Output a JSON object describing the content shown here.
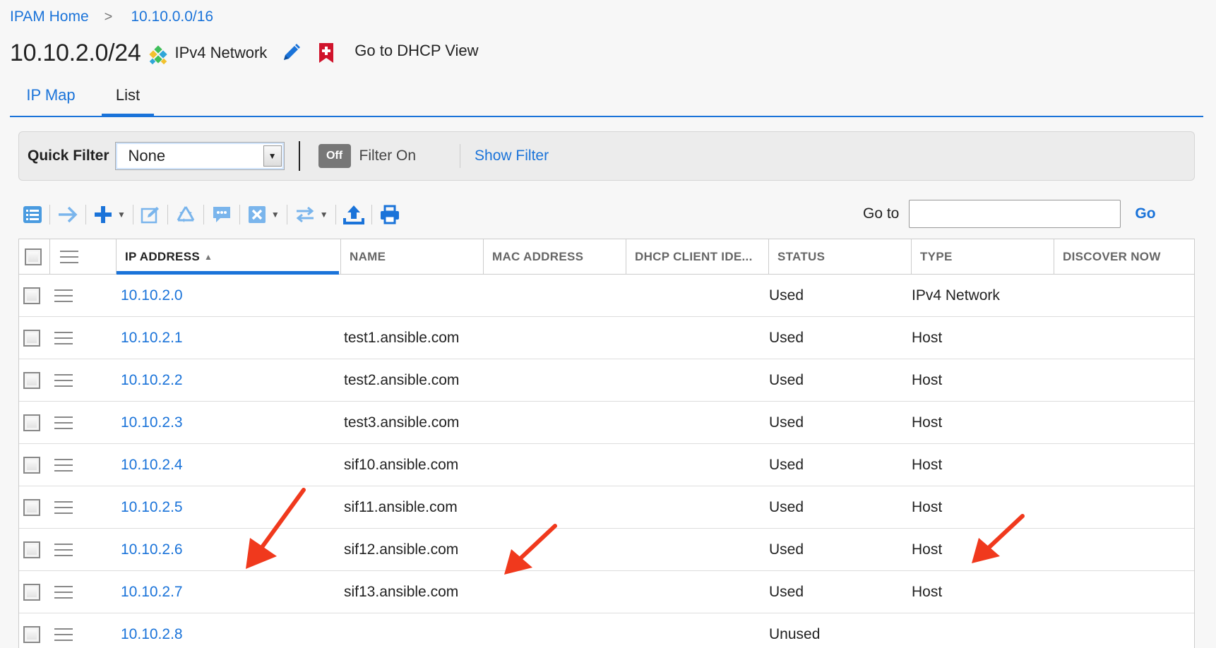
{
  "breadcrumb": {
    "home": "IPAM Home",
    "separator": ">",
    "parent": "10.10.0.0/16"
  },
  "header": {
    "network": "10.10.2.0/24",
    "network_type": "IPv4 Network",
    "dhcp_link": "Go to DHCP View"
  },
  "tabs": [
    {
      "label": "IP Map"
    },
    {
      "label": "List"
    }
  ],
  "filter": {
    "label": "Quick Filter",
    "selected": "None",
    "toggle": "Off",
    "toggle_text": "Filter On",
    "show_filter": "Show Filter"
  },
  "toolbar": {
    "icons": [
      "list-view-icon",
      "next-arrow-icon",
      "add-icon",
      "edit-icon",
      "recycle-icon",
      "comment-icon",
      "delete-icon",
      "swap-icon",
      "upload-icon",
      "print-icon"
    ],
    "goto_label": "Go to",
    "goto_value": "",
    "go_label": "Go"
  },
  "table": {
    "columns": [
      "IP ADDRESS",
      "NAME",
      "MAC ADDRESS",
      "DHCP CLIENT IDE...",
      "STATUS",
      "TYPE",
      "DISCOVER NOW"
    ],
    "rows": [
      {
        "ip": "10.10.2.0",
        "name": "",
        "mac": "",
        "dhcp": "",
        "status": "Used",
        "type": "IPv4 Network",
        "discover": ""
      },
      {
        "ip": "10.10.2.1",
        "name": "test1.ansible.com",
        "mac": "",
        "dhcp": "",
        "status": "Used",
        "type": "Host",
        "discover": ""
      },
      {
        "ip": "10.10.2.2",
        "name": "test2.ansible.com",
        "mac": "",
        "dhcp": "",
        "status": "Used",
        "type": "Host",
        "discover": ""
      },
      {
        "ip": "10.10.2.3",
        "name": "test3.ansible.com",
        "mac": "",
        "dhcp": "",
        "status": "Used",
        "type": "Host",
        "discover": ""
      },
      {
        "ip": "10.10.2.4",
        "name": "sif10.ansible.com",
        "mac": "",
        "dhcp": "",
        "status": "Used",
        "type": "Host",
        "discover": ""
      },
      {
        "ip": "10.10.2.5",
        "name": "sif11.ansible.com",
        "mac": "",
        "dhcp": "",
        "status": "Used",
        "type": "Host",
        "discover": ""
      },
      {
        "ip": "10.10.2.6",
        "name": "sif12.ansible.com",
        "mac": "",
        "dhcp": "",
        "status": "Used",
        "type": "Host",
        "discover": ""
      },
      {
        "ip": "10.10.2.7",
        "name": "sif13.ansible.com",
        "mac": "",
        "dhcp": "",
        "status": "Used",
        "type": "Host",
        "discover": ""
      },
      {
        "ip": "10.10.2.8",
        "name": "",
        "mac": "",
        "dhcp": "",
        "status": "Unused",
        "type": "",
        "discover": ""
      }
    ]
  },
  "colors": {
    "accent": "#1a73d9",
    "annotation_arrow": "#f0391d"
  }
}
